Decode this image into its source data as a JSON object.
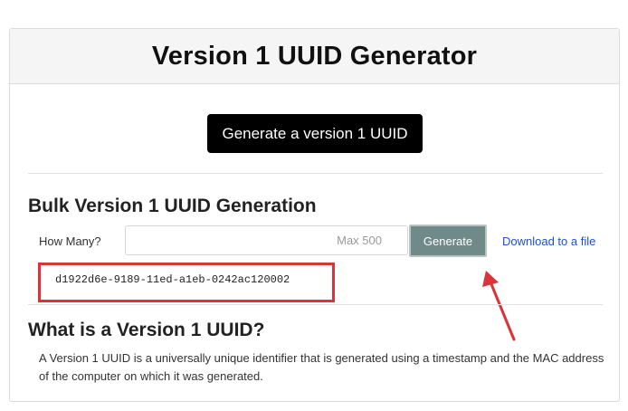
{
  "header": {
    "title": "Version 1 UUID Generator"
  },
  "single": {
    "button_label": "Generate a version 1 UUID"
  },
  "bulk": {
    "heading": "Bulk Version 1 UUID Generation",
    "how_many_label": "How Many?",
    "input_value": "",
    "input_placeholder": "Max 500",
    "generate_label": "Generate",
    "download_label": "Download to a file",
    "result": "d1922d6e-9189-11ed-a1eb-0242ac120002"
  },
  "about": {
    "heading": "What is a Version 1 UUID?",
    "body": "A Version 1 UUID is a universally unique identifier that is generated using a timestamp and the MAC address of the computer on which it was generated."
  },
  "colors": {
    "annotation": "#d9343a",
    "link": "#1a4fd6",
    "bulk_button": "#6f8a88"
  }
}
